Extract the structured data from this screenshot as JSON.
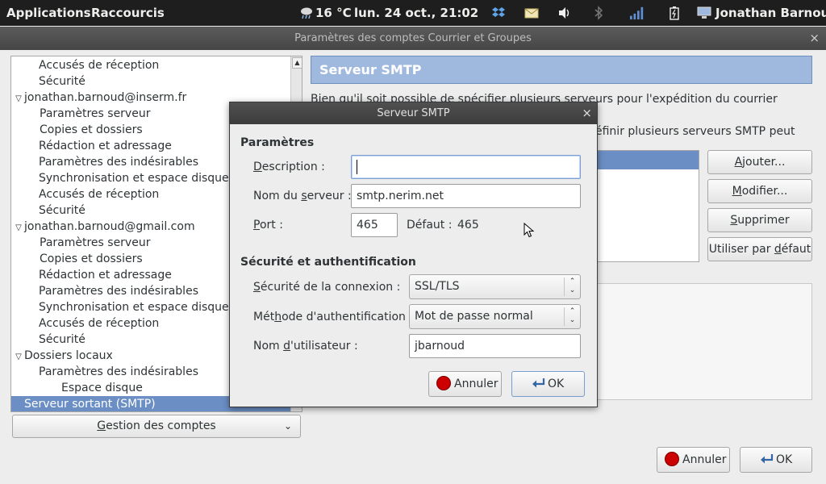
{
  "top_panel": {
    "applications": "Applications",
    "shortcuts": "Raccourcis",
    "weather": "16 °C",
    "clock": "lun. 24 oct., 21:02",
    "user": "Jonathan Barnoud"
  },
  "main_window": {
    "title": "Paramètres des comptes Courrier et Groupes",
    "close_glyph": "×"
  },
  "tree": {
    "items": [
      {
        "label": "Accusés de réception"
      },
      {
        "label": "Sécurité"
      },
      {
        "label": "jonathan.barnoud@inserm.fr"
      },
      {
        "label": "Paramètres serveur"
      },
      {
        "label": "Copies et dossiers"
      },
      {
        "label": "Rédaction et adressage"
      },
      {
        "label": "Paramètres des indésirables"
      },
      {
        "label": "Synchronisation et espace disque"
      },
      {
        "label": "Accusés de réception"
      },
      {
        "label": "Sécurité"
      },
      {
        "label": "jonathan.barnoud@gmail.com"
      },
      {
        "label": "Paramètres serveur"
      },
      {
        "label": "Copies et dossiers"
      },
      {
        "label": "Rédaction et adressage"
      },
      {
        "label": "Paramètres des indésirables"
      },
      {
        "label": "Synchronisation et espace disque"
      },
      {
        "label": "Accusés de réception"
      },
      {
        "label": "Sécurité"
      },
      {
        "label": "Dossiers locaux"
      },
      {
        "label": "Paramètres des indésirables"
      },
      {
        "label": "Espace disque"
      },
      {
        "label": "Serveur sortant (SMTP)"
      }
    ]
  },
  "account_actions": {
    "label_pre": "",
    "label_u": "G",
    "label_post": "estion des comptes"
  },
  "smtp_panel": {
    "header": "Serveur SMTP",
    "intro_line1": "Bien qu'il soit possible de spécifier plusieurs serveurs pour l'expédition du courrier (SMTP), ce",
    "intro_line2": "éfinir plusieurs serveurs SMTP peut",
    "buttons": {
      "add": {
        "u": "A",
        "rest": "jouter..."
      },
      "modify": {
        "u": "M",
        "rest": "odifier..."
      },
      "delete": {
        "u": "S",
        "rest": "upprimer"
      },
      "default": {
        "pre": "Utiliser par ",
        "u": "d",
        "rest": "éfaut"
      }
    }
  },
  "footer_buttons": {
    "cancel": "Annuler",
    "ok": "OK"
  },
  "dialog": {
    "title": "Serveur SMTP",
    "close_glyph": "×",
    "section_params": "Paramètres",
    "description_label": {
      "u": "D",
      "rest": "escription :"
    },
    "description_value": "",
    "server_label": {
      "pre": "Nom du ",
      "u": "s",
      "rest": "erveur :"
    },
    "server_value": "smtp.nerim.net",
    "port_label": {
      "u": "P",
      "rest": "ort :"
    },
    "port_value": "465",
    "default_port_label": "Défaut :",
    "default_port_value": "465",
    "section_security": "Sécurité et authentification",
    "conn_security_label": {
      "pre": "",
      "u": "S",
      "rest": "écurité de la connexion :"
    },
    "conn_security_value": "SSL/TLS",
    "auth_method_label": {
      "pre": "Mét",
      "u": "h",
      "rest": "ode d'authentification :"
    },
    "auth_method_value": "Mot de passe normal",
    "username_label": {
      "pre": "Nom ",
      "u": "d",
      "rest": "'utilisateur :"
    },
    "username_value": "jbarnoud",
    "cancel": "Annuler",
    "ok": "OK"
  }
}
